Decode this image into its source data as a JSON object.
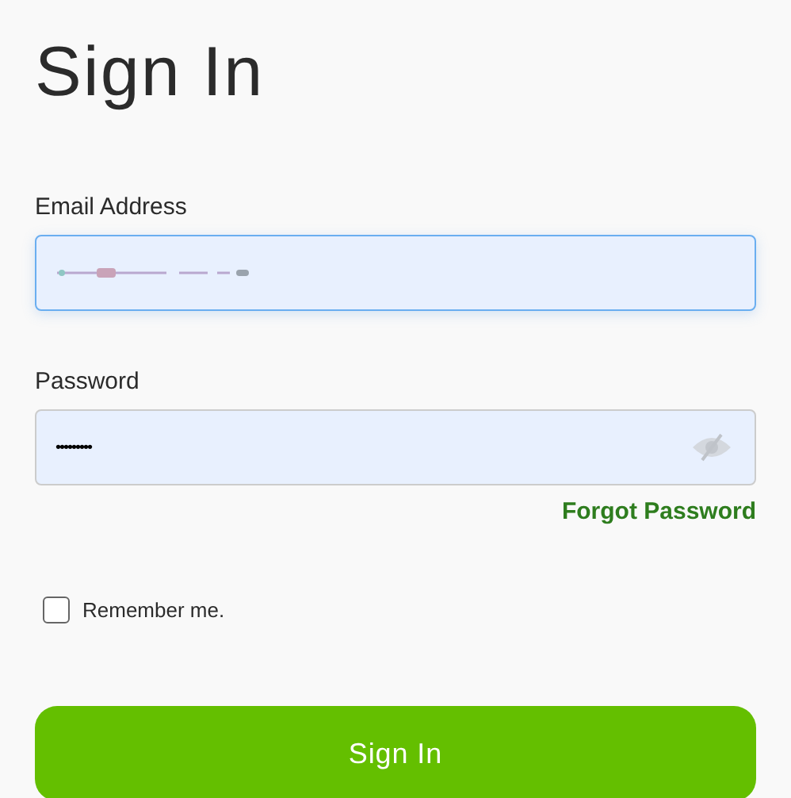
{
  "title": "Sign In",
  "email": {
    "label": "Email Address",
    "focused": true,
    "value_redacted": true
  },
  "password": {
    "label": "Password",
    "value": "•••••••••",
    "focused": false
  },
  "forgot_link": "Forgot Password",
  "remember": {
    "label": "Remember me.",
    "checked": false
  },
  "submit": "Sign In"
}
